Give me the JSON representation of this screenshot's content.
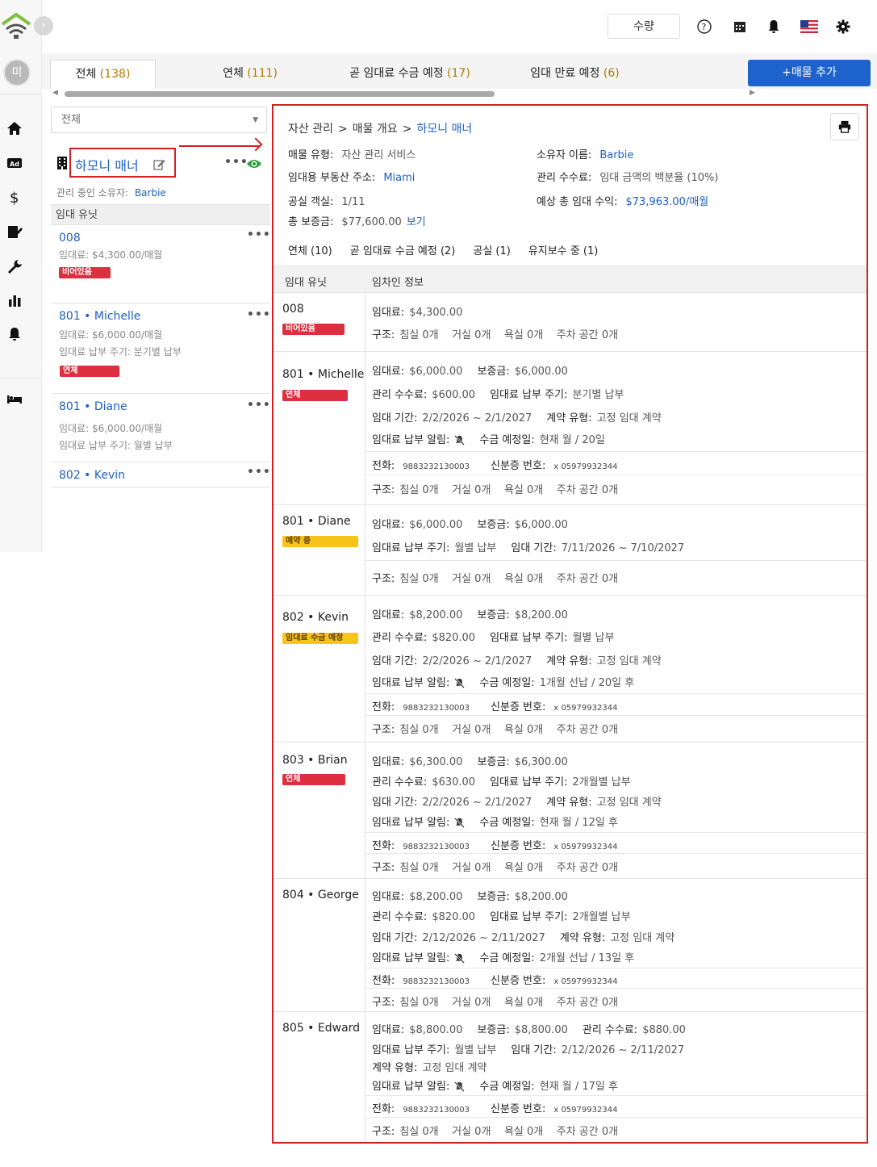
{
  "nav": {
    "avatar_letter": "미",
    "expand_glyph": "›"
  },
  "topbar": {
    "quantity_button": "수량"
  },
  "tabs": [
    {
      "label": "전체",
      "count": "(138)"
    },
    {
      "label": "연체",
      "count": "(111)"
    },
    {
      "label": "곧 임대료 수금 예정",
      "count": "(17)"
    },
    {
      "label": "임대 만료 예정",
      "count": "(6)"
    }
  ],
  "add_button": "+매물 추가",
  "filter": {
    "value": "전체"
  },
  "property": {
    "name": "하모니 매너",
    "owner_label": "관리 중인 소유자:",
    "owner": "Barbie",
    "units_header": "임대 유닛"
  },
  "unit_list": [
    {
      "title": "008",
      "rent": "임대료:  $4,300.00/매월",
      "cycle": "",
      "badge": "비어있음"
    },
    {
      "title": "801 • Michelle",
      "rent": "임대료:  $6,000.00/매월",
      "cycle": "임대료 납부 주기:  분기별 납부",
      "badge": "연체"
    },
    {
      "title": "801 • Diane",
      "rent": "임대료:  $6,000.00/매월",
      "cycle": "임대료 납부 주기:  월별 납부",
      "badge": ""
    },
    {
      "title": "802 • Kevin",
      "rent": "",
      "cycle": "",
      "badge": ""
    }
  ],
  "detail": {
    "breadcrumb": [
      "자산 관리",
      "매물 개요",
      "하모니 매너"
    ],
    "property_type_label": "매물 유형:",
    "property_type": "자산 관리 서비스",
    "address_label": "임대용 부동산 주소:",
    "address": "Miami",
    "vacancy_label": "공실 객실:",
    "vacancy": "1/11",
    "deposit_label": "총 보증금:",
    "deposit": "$77,600.00",
    "deposit_link": "보기",
    "owner_label": "소유자 이름:",
    "owner": "Barbie",
    "fee_label": "관리 수수료:",
    "fee": "임대 금액의 백분율 (10%)",
    "income_label": "예상 총 임대 수익:",
    "income": "$73,963.00/매월",
    "filters": [
      "연체 (10)",
      "곧 임대료 수금 예정 (2)",
      "공실 (1)",
      "유지보수 중 (1)"
    ],
    "col_unit": "임대 유닛",
    "col_tenant": "임차인 정보"
  },
  "labels": {
    "rent": "임대료:",
    "deposit": "보증금:",
    "fee": "관리 수수료:",
    "cycle": "임대료 납부 주기:",
    "period": "임대 기간:",
    "contract": "계약 유형:",
    "reminder": "임대료 납부 알림:",
    "due": "수금 예정일:",
    "phone": "전화:",
    "id": "신분증 번호:",
    "struct": "구조:"
  },
  "rows": [
    {
      "unit": "008",
      "badge": "비어있음",
      "rent": "$4,300.00",
      "struct": "침실 0개    거실 0개    욕실 0개    주차 공간 0개"
    },
    {
      "unit": "801 • Michelle",
      "badge": "연체",
      "rent": "$6,000.00",
      "deposit": "$6,000.00",
      "fee": "$600.00",
      "cycle": "분기별 납부",
      "period": "2/2/2026 ~ 2/1/2027",
      "contract": "고정 임대 계약",
      "due": "현재 월 / 20일",
      "phone": "9883232130003",
      "id": "x 05979932344",
      "struct": "침실 0개    거실 0개    욕실 0개    주차 공간 0개"
    },
    {
      "unit": "801 • Diane",
      "badge": "예약 중",
      "rent": "$6,000.00",
      "deposit": "$6,000.00",
      "cycle": "월별 납부",
      "period": "7/11/2026 ~ 7/10/2027",
      "struct": "침실 0개    거실 0개    욕실 0개    주차 공간 0개"
    },
    {
      "unit": "802 • Kevin",
      "badge": "임대료 수금 예정",
      "rent": "$8,200.00",
      "deposit": "$8,200.00",
      "fee": "$820.00",
      "cycle": "월별 납부",
      "period": "2/2/2026 ~ 2/1/2027",
      "contract": "고정 임대 계약",
      "due": "1개월 선납 / 20일 후",
      "phone": "9883232130003",
      "id": "x 05979932344",
      "struct": "침실 0개    거실 0개    욕실 0개    주차 공간 0개"
    },
    {
      "unit": "803 • Brian",
      "badge": "연체",
      "rent": "$6,300.00",
      "deposit": "$6,300.00",
      "fee": "$630.00",
      "cycle": "2개월별 납부",
      "period": "2/2/2026 ~ 2/1/2027",
      "contract": "고정 임대 계약",
      "due": "현재 월 / 12일 후",
      "phone": "9883232130003",
      "id": "x 05979932344",
      "struct": "침실 0개    거실 0개    욕실 0개    주차 공간 0개"
    },
    {
      "unit": "804 • George",
      "badge": "",
      "rent": "$8,200.00",
      "deposit": "$8,200.00",
      "fee": "$820.00",
      "cycle": "2개월별 납부",
      "period": "2/12/2026 ~ 2/11/2027",
      "contract": "고정 임대 계약",
      "due": "2개월 선납 / 13일 후",
      "phone": "9883232130003",
      "id": "x 05979932344",
      "struct": "침실 0개    거실 0개    욕실 0개    주차 공간 0개"
    },
    {
      "unit": "805 • Edward",
      "badge": "",
      "rent": "$8,800.00",
      "deposit": "$8,800.00",
      "fee": "$880.00",
      "cycle": "월별 납부",
      "period": "2/12/2026 ~ 2/11/2027",
      "contract": "고정 임대 계약",
      "due": "현재 월 / 17일 후",
      "phone": "9883232130003",
      "id": "x 05979932344",
      "struct": "침실 0개    거실 0개    욕실 0개    주차 공간 0개"
    }
  ],
  "colors": {
    "accent": "#1e63cc",
    "link": "#1e5fc2",
    "overdue": "#dc2f3f",
    "reserved": "#f7c51a",
    "highlight": "#d32020"
  }
}
